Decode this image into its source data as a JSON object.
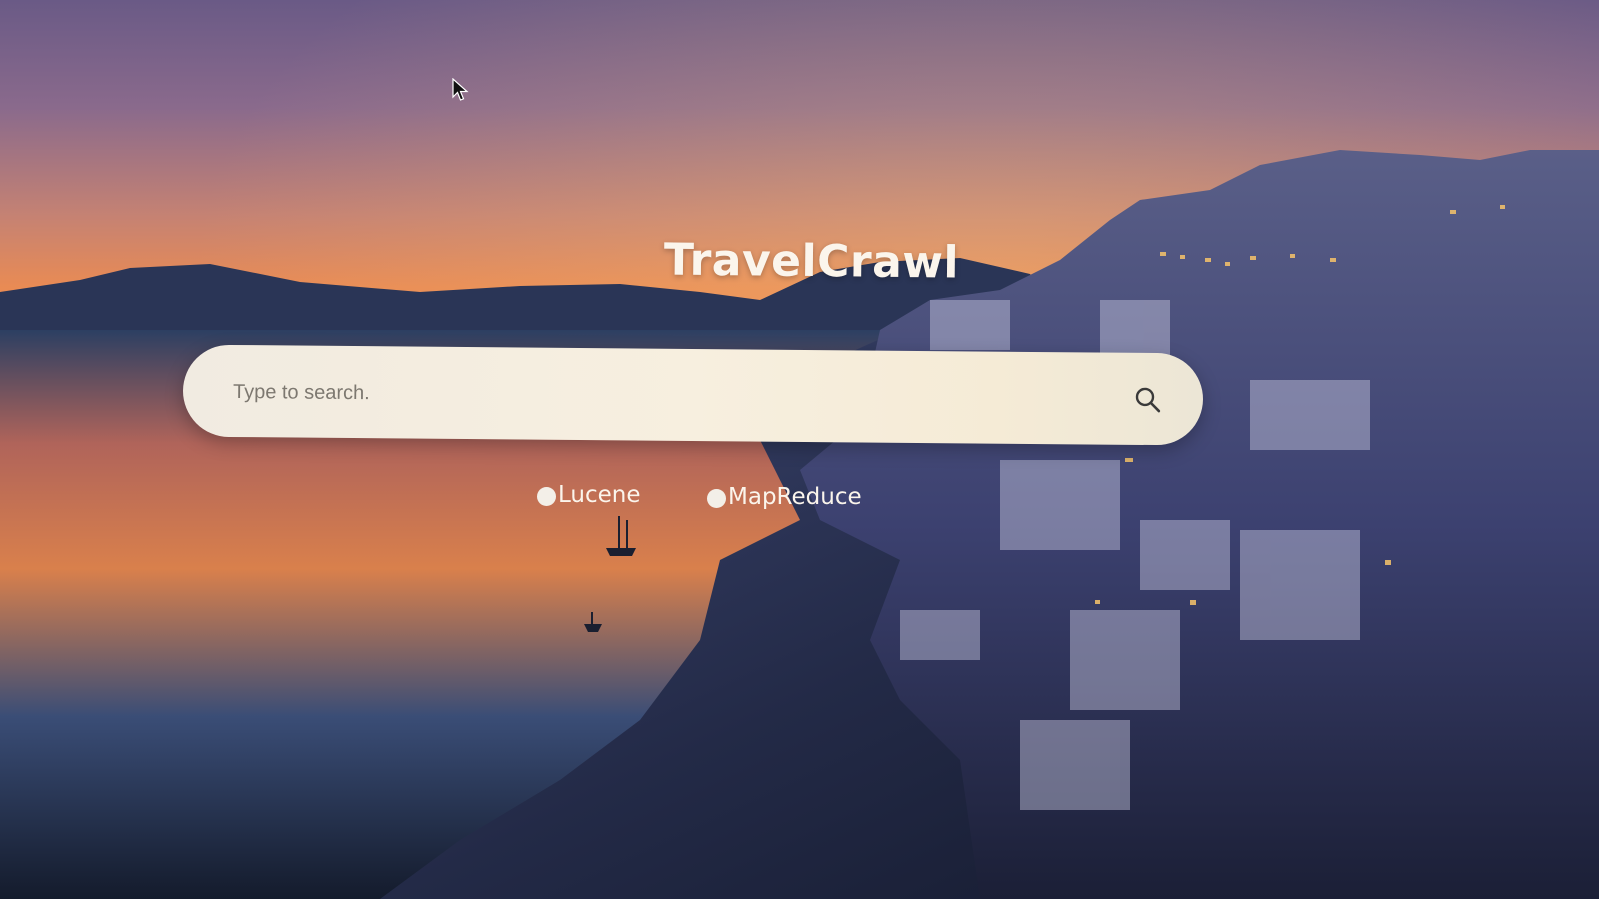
{
  "app": {
    "title": "TravelCrawl"
  },
  "search": {
    "placeholder": "Type to search.",
    "value": "",
    "icon": "search-icon"
  },
  "options": [
    {
      "label": "Lucene",
      "icon": "radio-dot-icon"
    },
    {
      "label": "MapReduce",
      "icon": "radio-dot-icon"
    }
  ],
  "colors": {
    "title_text": "#fbf5ec",
    "search_bar_bg": "#f3ecdf",
    "placeholder_text": "#7d7870"
  }
}
